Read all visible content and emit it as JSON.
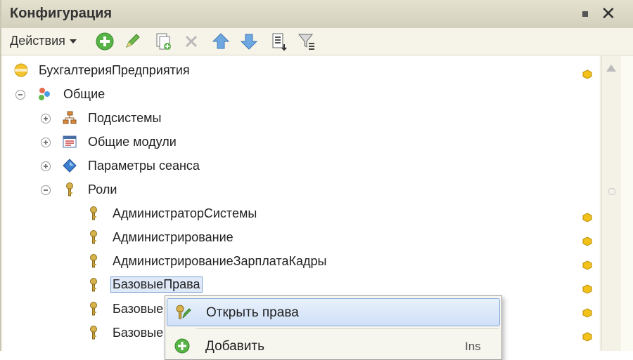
{
  "window": {
    "title": "Конфигурация"
  },
  "toolbar": {
    "actions_label": "Действия"
  },
  "tree": {
    "root": "БухгалтерияПредприятия",
    "common": "Общие",
    "subsystems": "Подсистемы",
    "common_modules": "Общие модули",
    "session_params": "Параметры сеанса",
    "roles": "Роли",
    "role_items": [
      "АдминистраторСистемы",
      "Администрирование",
      "АдминистрированиеЗарплатаКадры",
      "БазовыеПрава",
      "Базовые",
      "Базовые"
    ]
  },
  "context_menu": {
    "open_rights": "Открыть права",
    "add": "Добавить",
    "add_shortcut": "Ins"
  }
}
